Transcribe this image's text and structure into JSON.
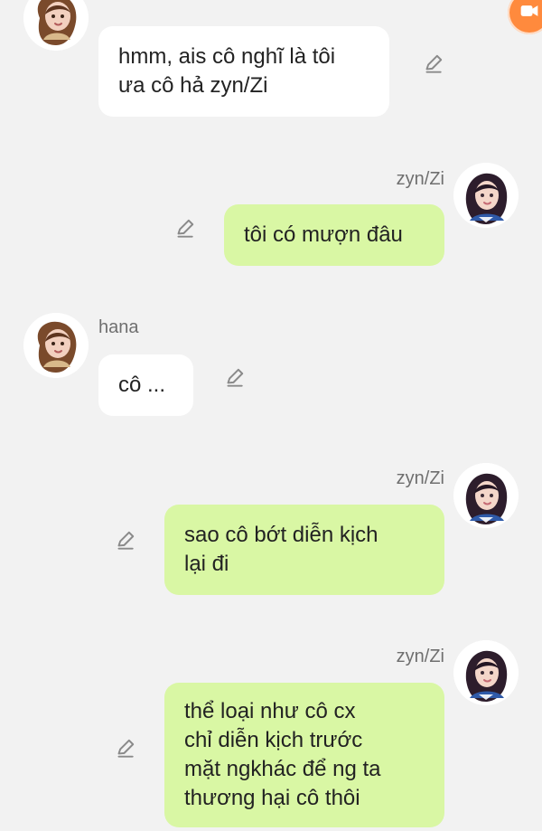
{
  "messages": [
    {
      "side": "left",
      "sender": "",
      "text": "hmm, ais cô nghĩ là tôi\nưa cô hả zyn/Zi",
      "avatar": "hana-avatar"
    },
    {
      "side": "right",
      "sender": "zyn/Zi",
      "text": "tôi có mượn đâu",
      "avatar": "zyn-avatar"
    },
    {
      "side": "left",
      "sender": "hana",
      "text": "cô ...",
      "avatar": "hana-avatar"
    },
    {
      "side": "right",
      "sender": "zyn/Zi",
      "text": "sao cô bớt diễn kịch\nlại đi",
      "avatar": "zyn-avatar"
    },
    {
      "side": "right",
      "sender": "zyn/Zi",
      "text": "thể loại như cô cx\nchỉ diễn kịch trước\nmặt ngkhác để ng ta\nthương hại cô thôi",
      "avatar": "zyn-avatar"
    }
  ],
  "icons": {
    "edit": "pencil-icon",
    "top_right": "video-icon"
  },
  "colors": {
    "background": "#f2f2f2",
    "bubble_left": "#ffffff",
    "bubble_right": "#d9f7a4",
    "sender_text": "#6f6f6f",
    "icon_gray": "#8a8a8a",
    "badge_orange": "#ff8a3d"
  }
}
